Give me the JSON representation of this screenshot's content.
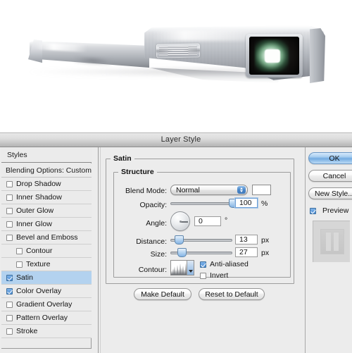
{
  "canvas": {
    "name": "layer-preview-canvas",
    "background": "#ffffff",
    "artwork_description": "Brushed aluminum device with vent grille and dark lens showing green glow"
  },
  "dialog": {
    "title": "Layer Style",
    "styles_panel": {
      "header": "Styles",
      "blending_options": "Blending Options: Custom",
      "effects": [
        {
          "label": "Drop Shadow",
          "checked": false,
          "indent": false,
          "selected": false
        },
        {
          "label": "Inner Shadow",
          "checked": false,
          "indent": false,
          "selected": false
        },
        {
          "label": "Outer Glow",
          "checked": false,
          "indent": false,
          "selected": false
        },
        {
          "label": "Inner Glow",
          "checked": false,
          "indent": false,
          "selected": false
        },
        {
          "label": "Bevel and Emboss",
          "checked": false,
          "indent": false,
          "selected": false
        },
        {
          "label": "Contour",
          "checked": false,
          "indent": true,
          "selected": false
        },
        {
          "label": "Texture",
          "checked": false,
          "indent": true,
          "selected": false
        },
        {
          "label": "Satin",
          "checked": true,
          "indent": false,
          "selected": true
        },
        {
          "label": "Color Overlay",
          "checked": true,
          "indent": false,
          "selected": false
        },
        {
          "label": "Gradient Overlay",
          "checked": false,
          "indent": false,
          "selected": false
        },
        {
          "label": "Pattern Overlay",
          "checked": false,
          "indent": false,
          "selected": false
        },
        {
          "label": "Stroke",
          "checked": false,
          "indent": false,
          "selected": false
        }
      ]
    },
    "settings": {
      "group_title": "Satin",
      "structure_title": "Structure",
      "blend_mode": {
        "label": "Blend Mode:",
        "value": "Normal",
        "color_swatch": "#ffffff"
      },
      "opacity": {
        "label": "Opacity:",
        "value": "100",
        "unit": "%",
        "slider_percent": 100
      },
      "angle": {
        "label": "Angle:",
        "value": "0",
        "unit": "°",
        "degrees": 0
      },
      "distance": {
        "label": "Distance:",
        "value": "13",
        "unit": "px",
        "slider_percent": 12
      },
      "size": {
        "label": "Size:",
        "value": "27",
        "unit": "px",
        "slider_percent": 17
      },
      "contour": {
        "label": "Contour:",
        "anti_aliased_label": "Anti-aliased",
        "anti_aliased_checked": true,
        "invert_label": "Invert",
        "invert_checked": false
      },
      "make_default": "Make Default",
      "reset_to_default": "Reset to Default"
    },
    "buttons": {
      "ok": "OK",
      "cancel": "Cancel",
      "new_style": "New Style...",
      "preview_label": "Preview",
      "preview_checked": true
    },
    "colors": {
      "selection_blue": "#b3d2ef",
      "accent_blue": "#4a86c8",
      "dialog_bg": "#ececec",
      "titlebar_top": "#e8e8e8",
      "titlebar_bottom": "#b4b4b4"
    }
  }
}
